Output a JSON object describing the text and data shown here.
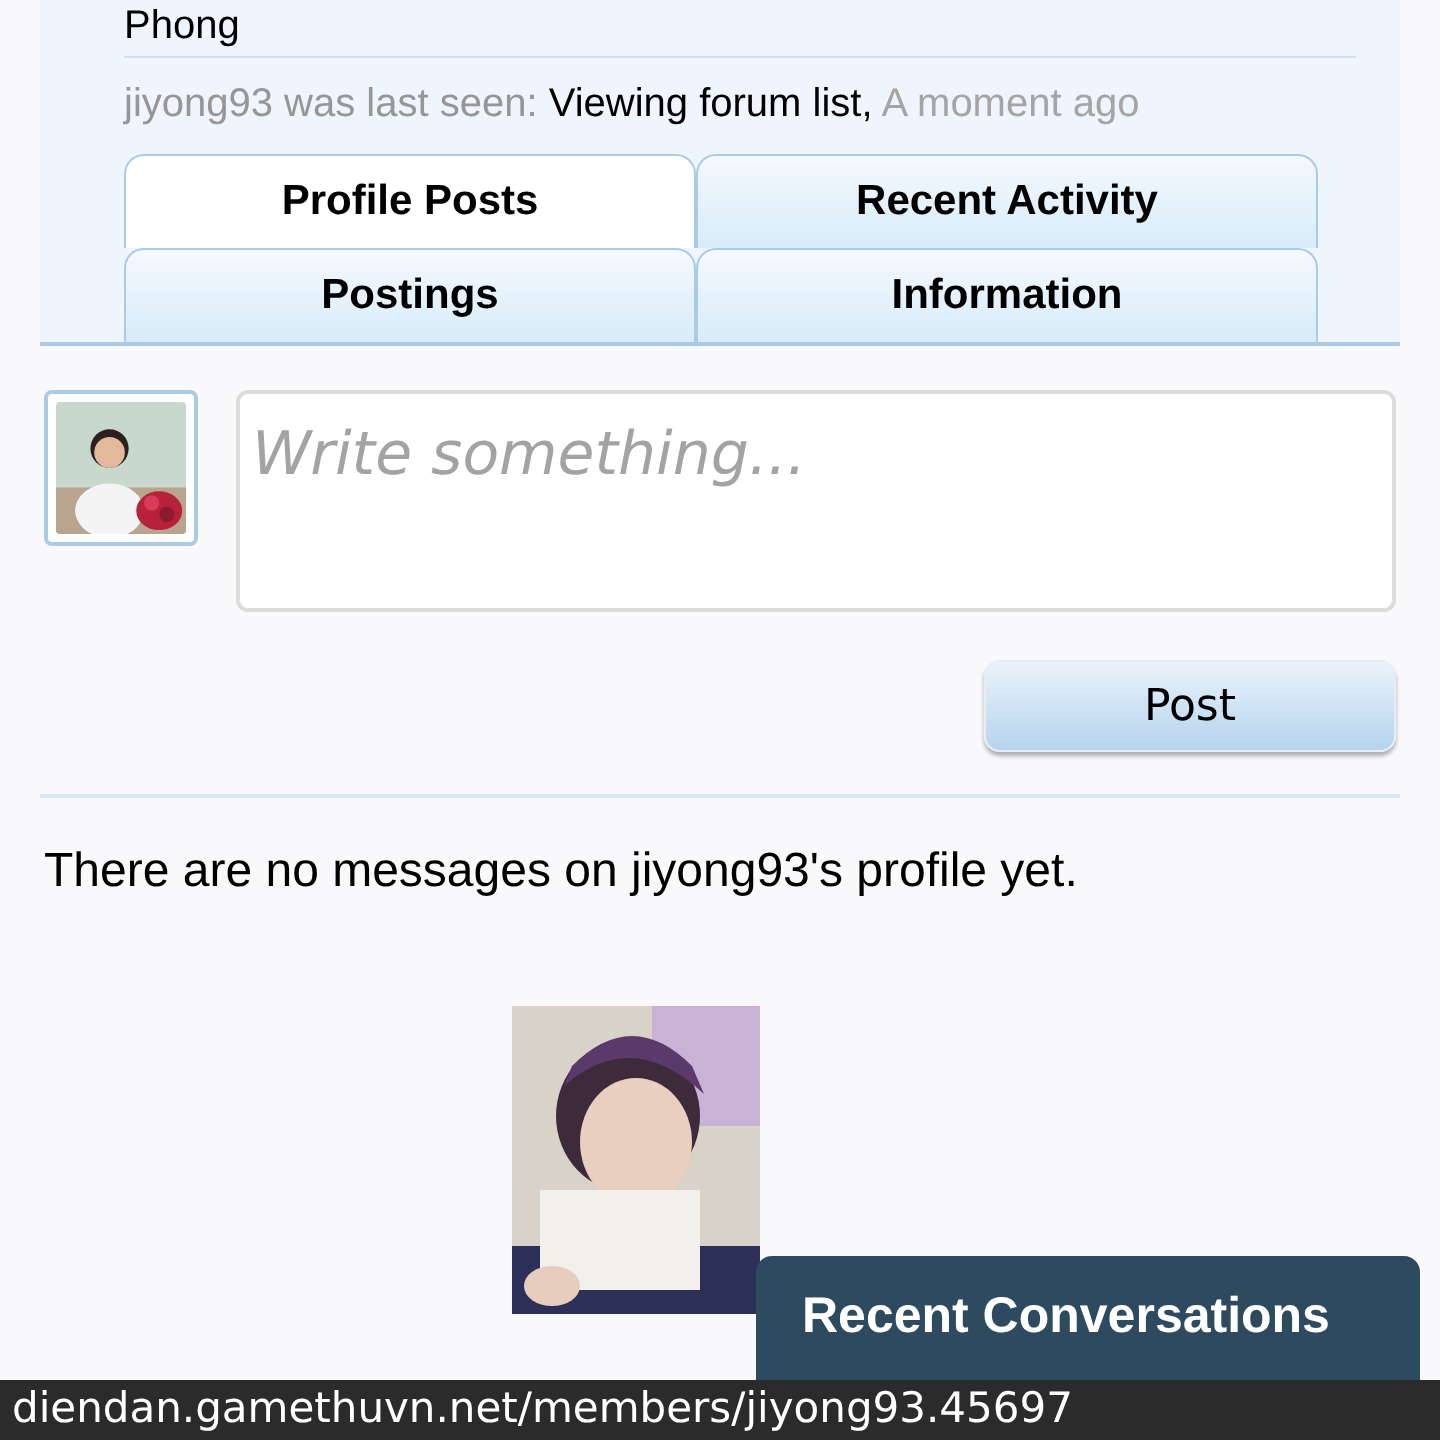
{
  "profile": {
    "name": "Phong",
    "last_seen": {
      "user_text": "jiyong93 was last seen:",
      "activity": "Viewing forum list,",
      "time": "A moment ago"
    }
  },
  "tabs": [
    {
      "label": "Profile Posts",
      "selected": true
    },
    {
      "label": "Recent Activity",
      "selected": false
    },
    {
      "label": "Postings",
      "selected": false
    },
    {
      "label": "Information",
      "selected": false
    }
  ],
  "composer": {
    "placeholder": "Write something...",
    "button": "Post"
  },
  "empty_message": "There are no messages on jiyong93's profile yet.",
  "recent_conversations": {
    "title": "Recent Conversations"
  },
  "status_bar": {
    "url": "diendan.gamethuvn.net/members/jiyong93.45697"
  }
}
